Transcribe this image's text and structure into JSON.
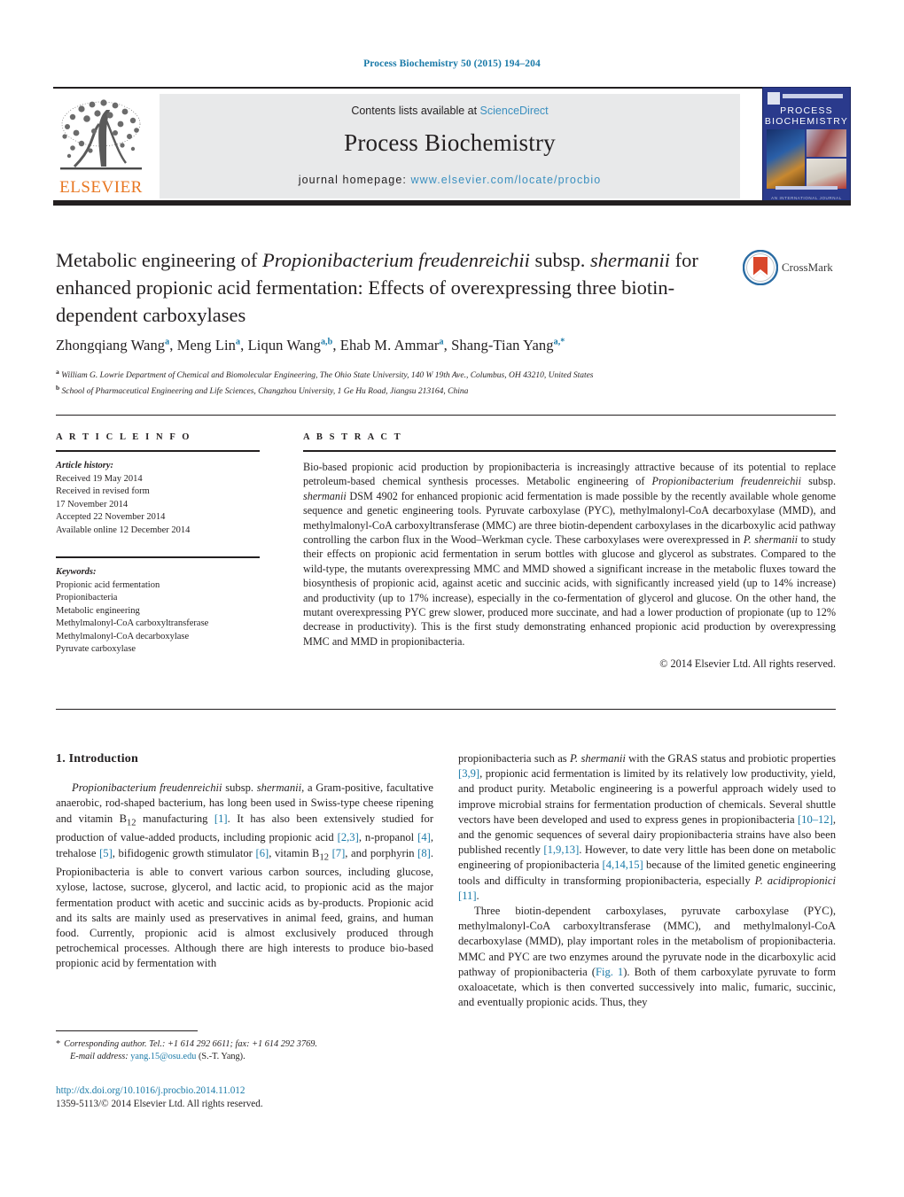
{
  "running_head": "Process Biochemistry 50 (2015) 194–204",
  "masthead": {
    "contents_prefix": "Contents lists available at ",
    "sciencedirect": "ScienceDirect",
    "journal_title": "Process Biochemistry",
    "homepage_prefix": "journal homepage: ",
    "homepage_url": "www.elsevier.com/locate/procbio",
    "publisher_logo_word": "ELSEVIER",
    "cover_title_line1": "PROCESS",
    "cover_title_line2": "BIOCHEMISTRY",
    "cover_publisher": "AN INTERNATIONAL JOURNAL"
  },
  "crossmark": {
    "label": "CrossMark"
  },
  "article": {
    "title_part1": "Metabolic engineering of ",
    "title_italic1": "Propionibacterium freudenreichii",
    "title_part2": " subsp. ",
    "title_italic2": "shermanii",
    "title_part3": " for enhanced propionic acid fermentation: Effects of overexpressing three biotin-dependent carboxylases",
    "authors": [
      {
        "name": "Zhongqiang Wang",
        "marks": "a"
      },
      {
        "name": "Meng Lin",
        "marks": "a"
      },
      {
        "name": "Liqun Wang",
        "marks": "a,b"
      },
      {
        "name": "Ehab M. Ammar",
        "marks": "a"
      },
      {
        "name": "Shang-Tian Yang",
        "marks": "a,*"
      }
    ],
    "affiliations": [
      {
        "mark": "a",
        "text": "William G. Lowrie Department of Chemical and Biomolecular Engineering, The Ohio State University, 140 W 19th Ave., Columbus, OH 43210, United States"
      },
      {
        "mark": "b",
        "text": "School of Pharmaceutical Engineering and Life Sciences, Changzhou University, 1 Ge Hu Road, Jiangsu 213164, China"
      }
    ]
  },
  "article_info": {
    "heading": "A R T I C L E    I N F O",
    "history_label": "Article history:",
    "history": [
      "Received 19 May 2014",
      "Received in revised form",
      "17 November 2014",
      "Accepted 22 November 2014",
      "Available online 12 December 2014"
    ],
    "keywords_label": "Keywords:",
    "keywords": [
      "Propionic acid fermentation",
      "Propionibacteria",
      "Metabolic engineering",
      "Methylmalonyl-CoA carboxyltransferase",
      "Methylmalonyl-CoA decarboxylase",
      "Pyruvate carboxylase"
    ]
  },
  "abstract": {
    "heading": "A B S T R A C T",
    "p1_a": "Bio-based propionic acid production by propionibacteria is increasingly attractive because of its potential to replace petroleum-based chemical synthesis processes. Metabolic engineering of ",
    "p1_i1": "Propionibacterium freudenreichii",
    "p1_b": " subsp. ",
    "p1_i2": "shermanii",
    "p1_c": " DSM 4902 for enhanced propionic acid fermentation is made possible by the recently available whole genome sequence and genetic engineering tools. Pyruvate carboxylase (PYC), methylmalonyl-CoA decarboxylase (MMD), and methylmalonyl-CoA carboxyltransferase (MMC) are three biotin-dependent carboxylases in the dicarboxylic acid pathway controlling the carbon flux in the Wood–Werkman cycle. These carboxylases were overexpressed in ",
    "p1_i3": "P. shermanii",
    "p1_d": " to study their effects on propionic acid fermentation in serum bottles with glucose and glycerol as substrates. Compared to the wild-type, the mutants overexpressing MMC and MMD showed a significant increase in the metabolic fluxes toward the biosynthesis of propionic acid, against acetic and succinic acids, with significantly increased yield (up to 14% increase) and productivity (up to 17% increase), especially in the co-fermentation of glycerol and glucose. On the other hand, the mutant overexpressing PYC grew slower, produced more succinate, and had a lower production of propionate (up to 12% decrease in productivity). This is the first study demonstrating enhanced propionic acid production by overexpressing MMC and MMD in propionibacteria.",
    "copyright": "© 2014 Elsevier Ltd. All rights reserved."
  },
  "introduction": {
    "heading": "1.  Introduction",
    "left": {
      "p1_a": "",
      "i1": "Propionibacterium freudenreichii",
      "a2": " subsp. ",
      "i2": "shermanii",
      "a3": ", a Gram-positive, facultative anaerobic, rod-shaped bacterium, has long been used in Swiss-type cheese ripening and vitamin B",
      "sub1": "12",
      "a4": " manufacturing ",
      "r1": "[1]",
      "a5": ". It has also been extensively studied for production of value-added products, including propionic acid ",
      "r2": "[2,3]",
      "a6": ", n-propanol ",
      "r3": "[4]",
      "a7": ", trehalose ",
      "r4": "[5]",
      "a8": ", bifidogenic growth stimulator ",
      "r5": "[6]",
      "a9": ", vitamin B",
      "sub2": "12",
      "a10": " ",
      "r6": "[7]",
      "a11": ", and porphyrin ",
      "r7": "[8]",
      "a12": ". Propionibacteria is able to convert various carbon sources, including glucose, xylose, lactose, sucrose, glycerol, and lactic acid, to propionic acid as the major fermentation product with acetic and succinic acids as by-products. Propionic acid and its salts are mainly used as preservatives in animal feed, grains, and human food. Currently, propionic acid is almost exclusively produced through petrochemical processes. Although there are high interests to produce bio-based propionic acid by fermentation with"
    },
    "right": {
      "a1": "propionibacteria such as ",
      "i1": "P. shermanii",
      "a2": " with the GRAS status and probiotic properties ",
      "r1": "[3,9]",
      "a3": ", propionic acid fermentation is limited by its relatively low productivity, yield, and product purity. Metabolic engineering is a powerful approach widely used to improve microbial strains for fermentation production of chemicals. Several shuttle vectors have been developed and used to express genes in propionibacteria ",
      "r2": "[10–12]",
      "a4": ", and the genomic sequences of several dairy propionibacteria strains have also been published recently ",
      "r3": "[1,9,13]",
      "a5": ". However, to date very little has been done on metabolic engineering of propionibacteria ",
      "r4": "[4,14,15]",
      "a6": " because of the limited genetic engineering tools and difficulty in transforming propionibacteria, especially ",
      "i2": "P. acidipropionici",
      "a7": " ",
      "r5": "[11]",
      "a8": ".",
      "p2_a": "Three biotin-dependent carboxylases, pyruvate carboxylase (PYC), methylmalonyl-CoA carboxyltransferase (MMC), and methylmalonyl-CoA decarboxylase (MMD), play important roles in the metabolism of propionibacteria. MMC and PYC are two enzymes around the pyruvate node in the dicarboxylic acid pathway of propionibacteria (",
      "r6": "Fig. 1",
      "p2_b": "). Both of them carboxylate pyruvate to form oxaloacetate, which is then converted successively into malic, fumaric, succinic, and eventually propionic acids. Thus, they"
    }
  },
  "footnote": {
    "star": "*",
    "corresponding": "Corresponding author. Tel.: +1 614 292 6611; fax: +1 614 292 3769.",
    "email_label": "E-mail address:",
    "email": "yang.15@osu.edu",
    "email_suffix": " (S.-T. Yang)."
  },
  "doi_block": {
    "doi": "http://dx.doi.org/10.1016/j.procbio.2014.11.012",
    "issn_line": "1359-5113/© 2014 Elsevier Ltd. All rights reserved."
  },
  "colors": {
    "link": "#1a7aa8",
    "sciencedirect": "#3a8fbf",
    "elsevier_orange": "#e87722",
    "cover_blue": "#2a3a8c",
    "band_gray": "#e8e9ea"
  }
}
